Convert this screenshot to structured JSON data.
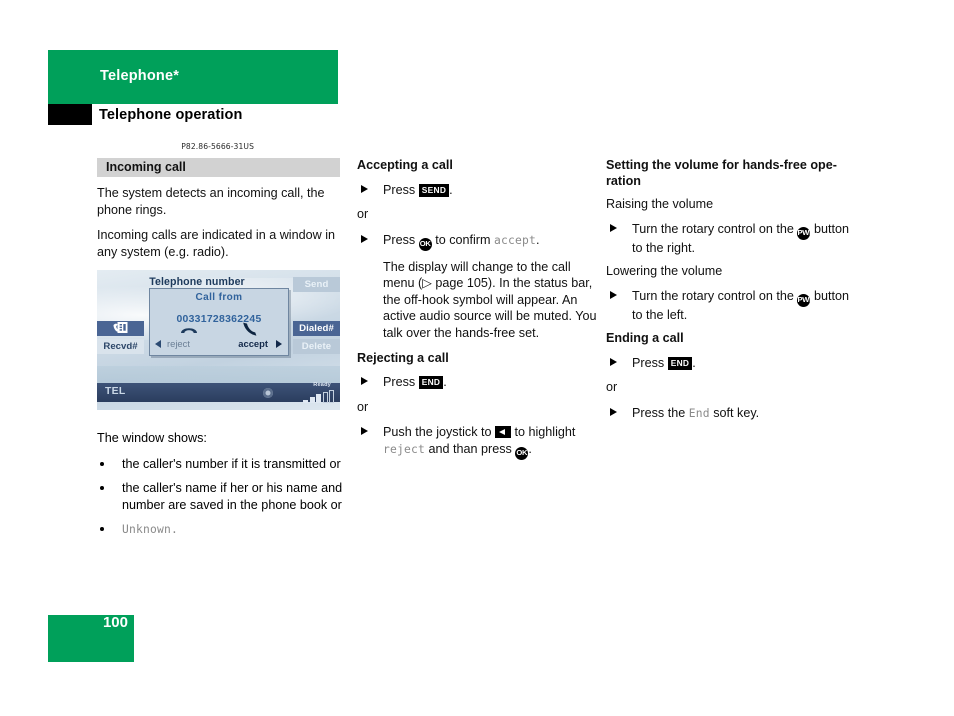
{
  "header": {
    "chapter": "Telephone*",
    "section": "Telephone operation"
  },
  "footer": {
    "page_number": "100"
  },
  "colors": {
    "brand_green": "#00a05a",
    "shaded_title_bg": "#d2d2d2",
    "screen_text_gray": "#8a8a8a"
  },
  "col1": {
    "title": "Incoming call",
    "para1": "The system detects an incoming call, the phone rings.",
    "para2": "Incoming calls are indicated in a window in any system (e.g. radio).",
    "window_shows_lead": "The window shows:",
    "bullets": [
      "the caller's number if it is transmitted or",
      "the caller's name if her or his name and number are saved in the phone book or"
    ],
    "bullet_unknown": "Unknown."
  },
  "figure": {
    "title": "Telephone number",
    "softkeys_right": [
      {
        "label": "Send",
        "state": "dim"
      },
      {
        "label": "Dialed#",
        "state": "active"
      },
      {
        "label": "Delete",
        "state": "dim"
      }
    ],
    "softkeys_left": [
      {
        "label": "phone-book-icon",
        "state": "active"
      },
      {
        "label": "Recvd#",
        "state": "light"
      }
    ],
    "popup": {
      "title": "Call from",
      "number": "00331728362245",
      "reject_label": "reject",
      "accept_label": "accept"
    },
    "statusbar": {
      "source": "TEL",
      "ready": "Ready"
    },
    "caption": "P82.86-5666-31US"
  },
  "col2": {
    "accepting": {
      "heading": "Accepting a call",
      "step1_pre": "Press",
      "step1_key": "SEND",
      "step1_post": ".",
      "or": "or",
      "step2_pre": "Press",
      "step2_key": "OK",
      "step2_mid": "to confirm",
      "step2_screen": "accept",
      "step2_post": ".",
      "explanation_1": "The display will change to the",
      "explanation_2": "call menu (",
      "explanation_pageref": "page 105",
      "explanation_3": "). In the status bar, the off-hook symbol will appear. An active audio source will be muted. You talk over the hands-free set."
    },
    "rejecting": {
      "heading": "Rejecting a call",
      "step1_pre": "Press",
      "step1_key": "END",
      "step1_post": ".",
      "or": "or",
      "step2_pre": "Push the joystick to",
      "step2_key": "left-arrow",
      "step2_mid": "to highlight",
      "step2_screen": "reject",
      "step2_post": "and than press",
      "step2_key2": "OK",
      "step2_end": "."
    }
  },
  "col3": {
    "volume": {
      "heading": "Setting the volume for hands-free ope-ration",
      "raising_label": "Raising the volume",
      "raising_pre": "Turn the rotary control on the",
      "raising_key": "PWR",
      "raising_post": "button to the right.",
      "lowering_label": "Lowering the volume",
      "lowering_pre": "Turn the rotary control on the",
      "lowering_key": "PWR",
      "lowering_post": "button to the left."
    },
    "ending": {
      "heading": "Ending a call",
      "step1_pre": "Press",
      "step1_key": "END",
      "step1_post": ".",
      "or": "or",
      "step2_pre": "Press the",
      "step2_screen": "End",
      "step2_post": "soft key."
    }
  }
}
